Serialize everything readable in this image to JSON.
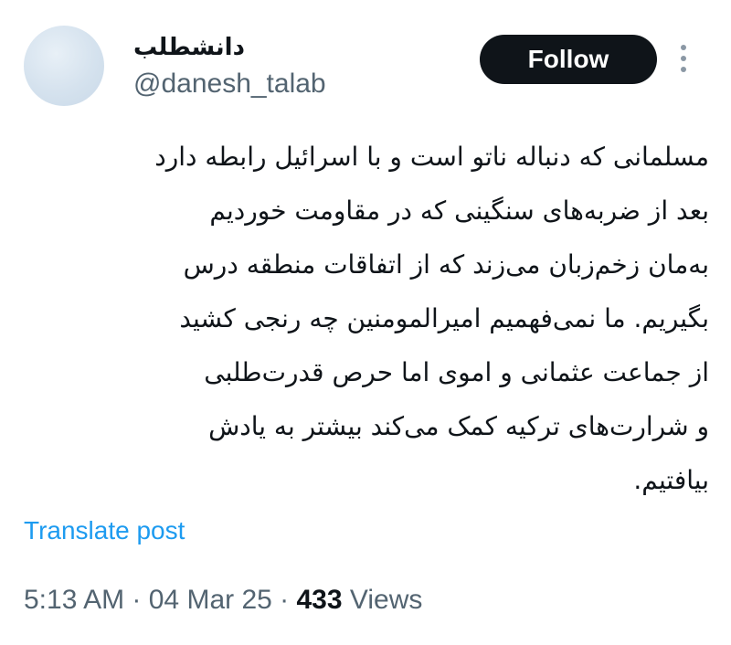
{
  "author": {
    "display_name": "دانشطلب",
    "handle": "@danesh_talab"
  },
  "actions": {
    "follow_label": "Follow",
    "more_icon": "more-vertical-icon"
  },
  "tweet": {
    "lines": [
      "مسلمانی که دنباله ناتو است و با اسرائیل رابطه دارد",
      "بعد از ضربه‌های سنگینی که در مقاومت خوردیم",
      "به‌مان زخم‌زبان می‌زند که از اتفاقات منطقه درس",
      "بگیریم. ما نمی‌فهمیم امیرالمومنین چه رنجی کشید",
      "از جماعت عثمانی و اموی اما حرص قدرت‌طلبی",
      "و شرارت‌های ترکیه کمک می‌کند بیشتر به یادش",
      "بیافتیم."
    ]
  },
  "translate_label": "Translate post",
  "meta": {
    "time": "5:13 AM",
    "separator": " · ",
    "date": "04 Mar 25",
    "views_count": "433",
    "views_label": " Views"
  },
  "colors": {
    "accent": "#1d9bf0",
    "text_primary": "#0f1419",
    "text_secondary": "#536471",
    "button_bg": "#0f1419"
  }
}
